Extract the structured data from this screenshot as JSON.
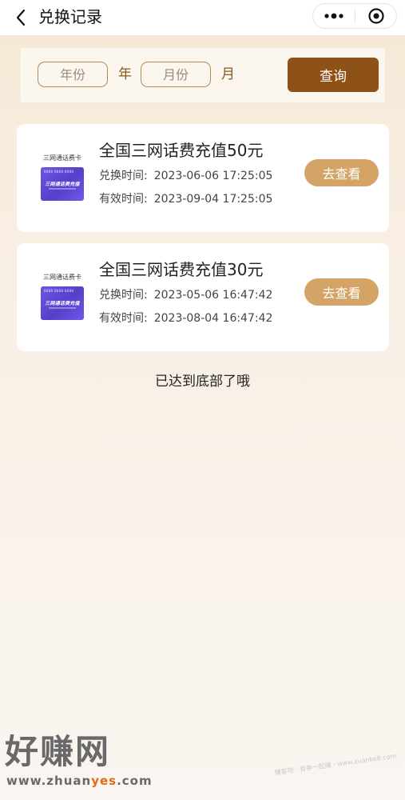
{
  "nav": {
    "title": "兑换记录",
    "back_icon": "chevron-left-icon",
    "more_icon": "more-dots-icon",
    "close_icon": "target-circle-icon"
  },
  "filter": {
    "year_placeholder": "年份",
    "year_unit": "年",
    "month_placeholder": "月份",
    "month_unit": "月",
    "query_label": "查询"
  },
  "records": [
    {
      "thumb_label": "三网通话费卡",
      "thumb_number": "8888 8888 8888",
      "thumb_title": "三网通话费充值",
      "name": "全国三网话费充值50元",
      "exchange_label": "兑换时间:",
      "exchange_time": "2023-06-06 17:25:05",
      "valid_label": "有效时间:",
      "valid_time": "2023-09-04 17:25:05",
      "view_label": "去查看"
    },
    {
      "thumb_label": "三网通话费卡",
      "thumb_number": "8888 8888 8888",
      "thumb_title": "三网通话费充值",
      "name": "全国三网话费充值30元",
      "exchange_label": "兑换时间:",
      "exchange_time": "2023-05-06 16:47:42",
      "valid_label": "有效时间:",
      "valid_time": "2023-08-04 16:47:42",
      "view_label": "去查看"
    }
  ],
  "end_text": "已达到底部了哦",
  "watermark": {
    "logo_text": "好赚网",
    "url_pre": "www.zhuan",
    "url_hl": "yes",
    "url_post": ".com",
    "small_text": "赚客吧 · 有券一起赚 · www.zuanke8.com"
  },
  "colors": {
    "accent_brown": "#8f5216",
    "button_gold": "#d4a366",
    "field_border": "#b08a5a",
    "card_purple": "#5a45d0"
  }
}
